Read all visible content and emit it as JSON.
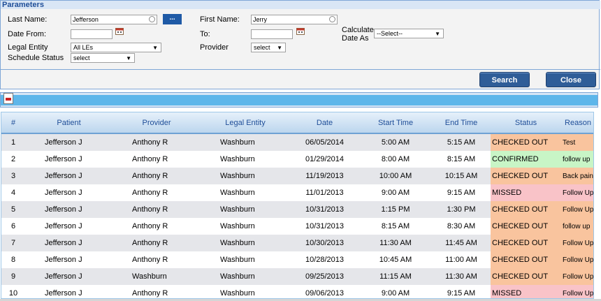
{
  "params": {
    "title": "Parameters",
    "last_name_label": "Last Name:",
    "last_name_value": "Jefferson",
    "first_name_label": "First Name:",
    "first_name_value": "Jerry",
    "lookup_button": "...",
    "date_from_label": "Date From:",
    "date_from_value": "",
    "to_label": "To:",
    "to_value": "",
    "calc_label_1": "Calculate",
    "calc_label_2": "Date As",
    "calc_value": "--Select--",
    "legal_entity_label": "Legal Entity",
    "legal_entity_value": "All LEs",
    "provider_label": "Provider",
    "provider_value": "select",
    "schedule_status_label": "Schedule Status",
    "schedule_status_value": "select"
  },
  "buttons": {
    "search": "Search",
    "close": "Close"
  },
  "toolbar": {
    "export_icon": "pdf-export-icon"
  },
  "grid": {
    "columns": [
      "#",
      "Patient",
      "Provider",
      "Legal Entity",
      "Date",
      "Start Time",
      "End Time",
      "Status",
      "Reason"
    ],
    "rows": [
      {
        "n": "1",
        "patient": "Jefferson J",
        "provider": "Anthony R",
        "le": "Washburn",
        "date": "06/05/2014",
        "start": "5:00 AM",
        "end": "5:15 AM",
        "status": "CHECKED OUT",
        "reason": "Test"
      },
      {
        "n": "2",
        "patient": "Jefferson J",
        "provider": "Anthony R",
        "le": "Washburn",
        "date": "01/29/2014",
        "start": "8:00 AM",
        "end": "8:15 AM",
        "status": "CONFIRMED",
        "reason": "follow up"
      },
      {
        "n": "3",
        "patient": "Jefferson J",
        "provider": "Anthony R",
        "le": "Washburn",
        "date": "11/19/2013",
        "start": "10:00 AM",
        "end": "10:15 AM",
        "status": "CHECKED OUT",
        "reason": "Back pain"
      },
      {
        "n": "4",
        "patient": "Jefferson J",
        "provider": "Anthony R",
        "le": "Washburn",
        "date": "11/01/2013",
        "start": "9:00 AM",
        "end": "9:15 AM",
        "status": "MISSED",
        "reason": "Follow Up"
      },
      {
        "n": "5",
        "patient": "Jefferson J",
        "provider": "Anthony R",
        "le": "Washburn",
        "date": "10/31/2013",
        "start": "1:15 PM",
        "end": "1:30 PM",
        "status": "CHECKED OUT",
        "reason": "Follow Up"
      },
      {
        "n": "6",
        "patient": "Jefferson J",
        "provider": "Anthony R",
        "le": "Washburn",
        "date": "10/31/2013",
        "start": "8:15 AM",
        "end": "8:30 AM",
        "status": "CHECKED OUT",
        "reason": "follow up"
      },
      {
        "n": "7",
        "patient": "Jefferson J",
        "provider": "Anthony R",
        "le": "Washburn",
        "date": "10/30/2013",
        "start": "11:30 AM",
        "end": "11:45 AM",
        "status": "CHECKED OUT",
        "reason": "Follow Up"
      },
      {
        "n": "8",
        "patient": "Jefferson J",
        "provider": "Anthony R",
        "le": "Washburn",
        "date": "10/28/2013",
        "start": "10:45 AM",
        "end": "11:00 AM",
        "status": "CHECKED OUT",
        "reason": "Follow Up"
      },
      {
        "n": "9",
        "patient": "Jefferson J",
        "provider": "Washburn",
        "le": "Washburn",
        "date": "09/25/2013",
        "start": "11:15 AM",
        "end": "11:30 AM",
        "status": "CHECKED OUT",
        "reason": "Follow Up"
      },
      {
        "n": "10",
        "patient": "Jefferson J",
        "provider": "Anthony R",
        "le": "Washburn",
        "date": "09/06/2013",
        "start": "9:00 AM",
        "end": "9:15 AM",
        "status": "MISSED",
        "reason": "Follow Up"
      }
    ]
  },
  "colors": {
    "header_text": "#1f4e98",
    "button_bg": "#2f5d98",
    "status_checked_out": "#f9c49e",
    "status_confirmed": "#c8f5c6",
    "status_missed": "#f9c3c8"
  }
}
